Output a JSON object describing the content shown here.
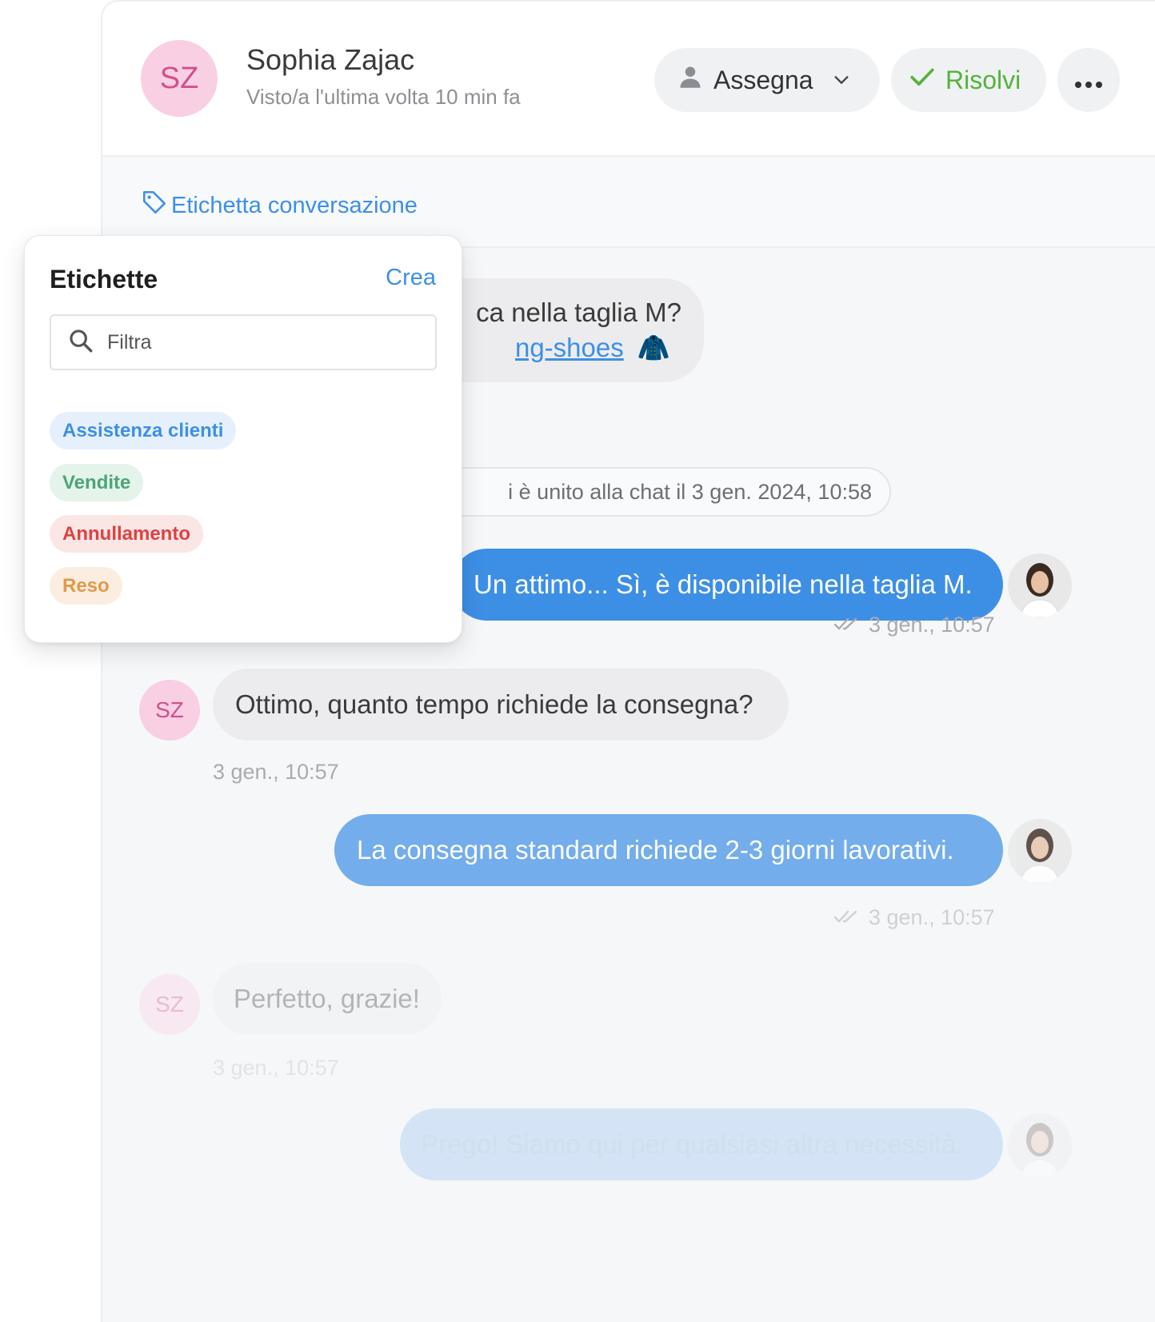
{
  "header": {
    "avatar_initials": "SZ",
    "name": "Sophia Zajac",
    "status": "Visto/a l'ultima volta 10 min fa",
    "assign_label": "Assegna",
    "resolve_label": "Risolvi"
  },
  "tag_link_label": "Etichetta conversazione",
  "dropdown": {
    "title": "Etichette",
    "create_label": "Crea",
    "filter_placeholder": "Filtra",
    "labels": [
      {
        "text": "Assistenza clienti",
        "color": "#3d8fe6",
        "bg": "#e6f0fc"
      },
      {
        "text": "Vendite",
        "color": "#4fa37a",
        "bg": "#e4f4ea"
      },
      {
        "text": "Annullamento",
        "color": "#e04040",
        "bg": "#fbe6e6"
      },
      {
        "text": "Reso",
        "color": "#e09a4a",
        "bg": "#fbede0"
      }
    ]
  },
  "chat": {
    "msg1_line1": "ca nella taglia M?",
    "msg1_link": "ng-shoes",
    "msg1_emoji": "🧥",
    "system_msg": "i è unito alla chat il 3 gen. 2024, 10:58",
    "msg2": "Un attimo... Sì, è disponibile nella taglia M.",
    "msg2_time": "3 gen., 10:57",
    "msg3_initials": "SZ",
    "msg3": "Ottimo, quanto tempo richiede la consegna?",
    "msg3_time": "3 gen., 10:57",
    "msg4": "La consegna standard richiede 2-3 giorni lavorativi.",
    "msg4_time": "3 gen., 10:57",
    "msg5_initials": "SZ",
    "msg5": "Perfetto, grazie!",
    "msg5_time": "3 gen., 10:57",
    "msg6": "Prego! Siamo qui per qualsiasi altra necessità."
  },
  "colors": {
    "accent": "#3d8fe6",
    "resolve": "#52b43a",
    "avatar_bg": "#f9cfe3",
    "avatar_text": "#d1508c"
  }
}
